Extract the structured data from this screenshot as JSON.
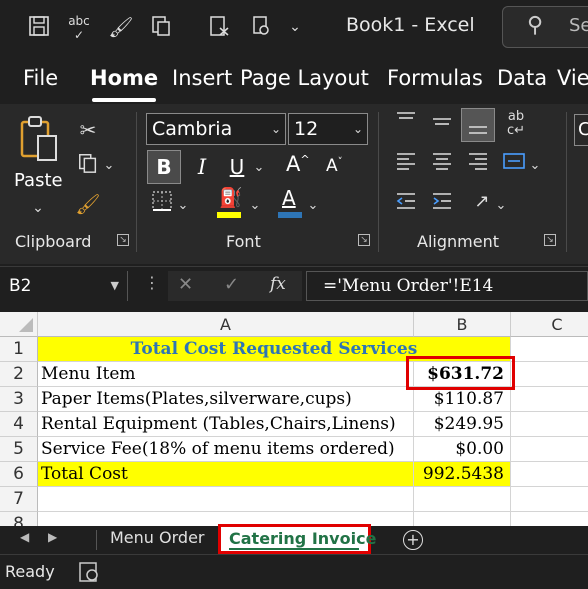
{
  "window": {
    "title": "Book1  -  Excel",
    "search_placeholder": "Se"
  },
  "qat": {
    "icons": [
      "save-icon",
      "spelling-icon",
      "format-painter-icon",
      "copy-icon",
      "print-preview-icon",
      "more-icon"
    ]
  },
  "menu": {
    "items": [
      "File",
      "Home",
      "Insert",
      "Page Layout",
      "Formulas",
      "Data",
      "Vie"
    ],
    "active": "Home"
  },
  "ribbon": {
    "clipboard": {
      "label": "Clipboard",
      "paste_label": "Paste"
    },
    "font": {
      "label": "Font",
      "font_name": "Cambria",
      "font_size": "12",
      "bold": "B",
      "italic": "I",
      "underline": "U",
      "grow": "A",
      "shrink": "A",
      "font_color_letter": "A"
    },
    "alignment": {
      "label": "Alignment"
    },
    "next_group_letter": "C"
  },
  "formula_bar": {
    "name_box": "B2",
    "fx": "fx",
    "formula": "='Menu Order'!E14"
  },
  "columns": [
    "A",
    "B",
    "C"
  ],
  "rows": [
    {
      "num": "1",
      "a": "Total Cost Requested Services",
      "b": ""
    },
    {
      "num": "2",
      "a": "Menu Item",
      "b": "$631.72"
    },
    {
      "num": "3",
      "a": "Paper Items(Plates,silverware,cups)",
      "b": "$110.87"
    },
    {
      "num": "4",
      "a": "Rental Equipment (Tables,Chairs,Linens)",
      "b": "$249.95"
    },
    {
      "num": "5",
      "a": "Service Fee(18% of menu items ordered)",
      "b": "$0.00"
    },
    {
      "num": "6",
      "a": "Total Cost",
      "b": "992.5438"
    },
    {
      "num": "7",
      "a": "",
      "b": ""
    },
    {
      "num": "8",
      "a": "",
      "b": ""
    }
  ],
  "sheet_tabs": {
    "items": [
      "Menu Order",
      "Catering Invoice"
    ],
    "active": "Catering Invoice",
    "add": "+"
  },
  "status": {
    "text": "Ready"
  },
  "colors": {
    "accent_green": "#217346",
    "highlight": "#ffff00",
    "title_blue": "#2e75b6",
    "annotation_red": "#e00000"
  }
}
